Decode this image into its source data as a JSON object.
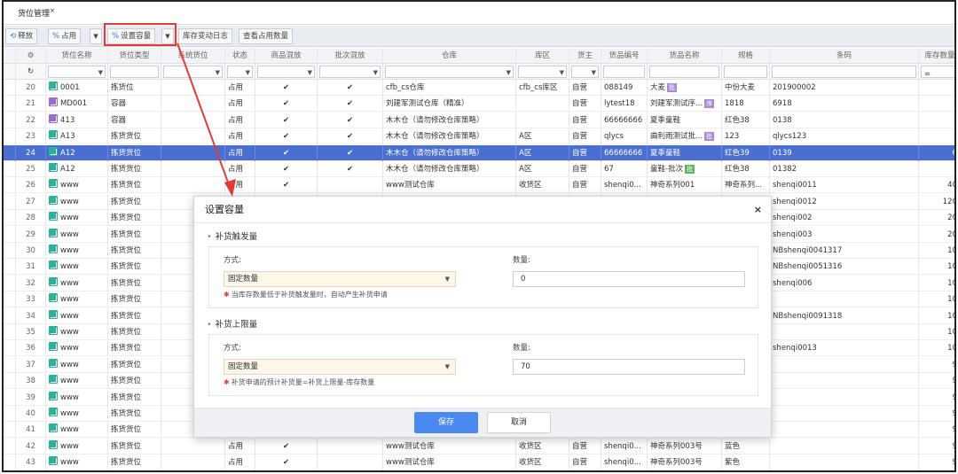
{
  "tab": {
    "title": "货位管理",
    "close": "×"
  },
  "toolbar": {
    "release": "释放",
    "occupy": "占用",
    "set_capacity": "设置容量",
    "stock_log": "库存变动日志",
    "view_occupy": "查看占用数量"
  },
  "columns": [
    "",
    "货位名称",
    "货位类型",
    "系统货位",
    "状态",
    "商品混放",
    "批次混放",
    "仓库",
    "库区",
    "货主",
    "货品编号",
    "货品名称",
    "规格",
    "条码",
    "库存数量"
  ],
  "filter": {
    "stock_op": "="
  },
  "rows": [
    {
      "n": "20",
      "name": "0001",
      "type": "拣货位",
      "status": "占用",
      "mix": "✔",
      "batch": "✔",
      "wh": "cfb_cs仓库",
      "zone": "cfb_cs库区",
      "owner": "自营",
      "code": "088149",
      "goods": "大麦",
      "tag": "批",
      "spec": "中份大麦",
      "barcode": "201900002",
      "qty": "",
      "icon": "green"
    },
    {
      "n": "21",
      "name": "MD001",
      "type": "容器",
      "status": "占用",
      "mix": "✔",
      "batch": "✔",
      "wh": "刘建军测试仓库（精准）",
      "zone": "",
      "owner": "自营",
      "code": "lytest18",
      "goods": "刘建军测试序...",
      "tag": "序",
      "spec": "1818",
      "barcode": "6918",
      "qty": "",
      "icon": "purple"
    },
    {
      "n": "22",
      "name": "413",
      "type": "容器",
      "status": "占用",
      "mix": "✔",
      "batch": "✔",
      "wh": "木木仓（请勿修改仓库策略）",
      "zone": "",
      "owner": "自营",
      "code": "66666666",
      "goods": "夏季童鞋",
      "tag": "",
      "spec": "红色38",
      "barcode": "0138",
      "qty": "",
      "icon": "purple"
    },
    {
      "n": "23",
      "name": "A13",
      "type": "拣货货位",
      "status": "占用",
      "mix": "✔",
      "batch": "✔",
      "wh": "木木仓（请勿修改仓库策略）",
      "zone": "A区",
      "owner": "自营",
      "code": "qlycs",
      "goods": "曲利雨测试批...",
      "tag": "批",
      "spec": "123",
      "barcode": "qlycs123",
      "qty": "",
      "icon": "green"
    },
    {
      "n": "24",
      "name": "A12",
      "type": "拣货货位",
      "status": "占用",
      "mix": "✔",
      "batch": "✔",
      "wh": "木木仓（请勿修改仓库策略）",
      "zone": "A区",
      "owner": "自营",
      "code": "66666666",
      "goods": "夏季童鞋",
      "tag": "",
      "spec": "红色39",
      "barcode": "0139",
      "qty": "6",
      "icon": "green",
      "selected": true
    },
    {
      "n": "25",
      "name": "A12",
      "type": "拣货货位",
      "status": "占用",
      "mix": "✔",
      "batch": "✔",
      "wh": "木木仓（请勿修改仓库策略）",
      "zone": "A区",
      "owner": "自营",
      "code": "67",
      "goods": "童鞋-批次",
      "tag": "批",
      "spec": "红色38",
      "barcode": "01382",
      "qty": "",
      "icon": "green"
    },
    {
      "n": "26",
      "name": "www",
      "type": "拣货货位",
      "status": "占用",
      "mix": "✔",
      "batch": "",
      "wh": "www测试仓库",
      "zone": "收货区",
      "owner": "自营",
      "code": "shenqi0...",
      "goods": "神奇系列001",
      "tag": "",
      "spec": "神奇系列...",
      "barcode": "shenqi0011",
      "qty": "40",
      "icon": "green"
    },
    {
      "n": "27",
      "name": "www",
      "type": "拣货货位",
      "status": "",
      "mix": "",
      "batch": "",
      "wh": "",
      "zone": "",
      "owner": "",
      "code": "",
      "goods": "",
      "tag": "",
      "spec": "",
      "barcode": "shenqi0012",
      "qty": "120",
      "icon": "green"
    },
    {
      "n": "28",
      "name": "www",
      "type": "拣货货位",
      "status": "",
      "mix": "",
      "batch": "",
      "wh": "",
      "zone": "",
      "owner": "",
      "code": "",
      "goods": "",
      "tag": "",
      "spec": "",
      "barcode": "shenqi002",
      "qty": "20",
      "icon": "green"
    },
    {
      "n": "29",
      "name": "www",
      "type": "拣货货位",
      "status": "",
      "mix": "",
      "batch": "",
      "wh": "",
      "zone": "",
      "owner": "",
      "code": "",
      "goods": "",
      "tag": "",
      "spec": "",
      "barcode": "shenqi003",
      "qty": "20",
      "icon": "green"
    },
    {
      "n": "30",
      "name": "www",
      "type": "拣货货位",
      "status": "",
      "mix": "",
      "batch": "",
      "wh": "",
      "zone": "",
      "owner": "",
      "code": "",
      "goods": "",
      "tag": "",
      "spec": "",
      "barcode": "NBshenqi0041317",
      "qty": "10",
      "icon": "green"
    },
    {
      "n": "31",
      "name": "www",
      "type": "拣货货位",
      "status": "",
      "mix": "",
      "batch": "",
      "wh": "",
      "zone": "",
      "owner": "",
      "code": "",
      "goods": "",
      "tag": "",
      "spec": "",
      "barcode": "NBshenqi0051316",
      "qty": "10",
      "icon": "green"
    },
    {
      "n": "32",
      "name": "www",
      "type": "拣货货位",
      "status": "",
      "mix": "",
      "batch": "",
      "wh": "",
      "zone": "",
      "owner": "",
      "code": "",
      "goods": "",
      "tag": "",
      "spec": "",
      "barcode": "shenqi006",
      "qty": "10",
      "icon": "green"
    },
    {
      "n": "33",
      "name": "www",
      "type": "拣货货位",
      "status": "",
      "mix": "",
      "batch": "",
      "wh": "",
      "zone": "",
      "owner": "",
      "code": "",
      "goods": "",
      "tag": "",
      "spec": "",
      "barcode": "",
      "qty": "10",
      "icon": "green"
    },
    {
      "n": "34",
      "name": "www",
      "type": "拣货货位",
      "status": "",
      "mix": "",
      "batch": "",
      "wh": "",
      "zone": "",
      "owner": "",
      "code": "",
      "goods": "",
      "tag": "",
      "spec": "",
      "barcode": "NBshenqi0091318",
      "qty": "10",
      "icon": "green"
    },
    {
      "n": "35",
      "name": "www",
      "type": "拣货货位",
      "status": "",
      "mix": "",
      "batch": "",
      "wh": "",
      "zone": "",
      "owner": "",
      "code": "",
      "goods": "",
      "tag": "",
      "spec": "",
      "barcode": "",
      "qty": "10",
      "icon": "green"
    },
    {
      "n": "36",
      "name": "www",
      "type": "拣货货位",
      "status": "",
      "mix": "",
      "batch": "",
      "wh": "",
      "zone": "",
      "owner": "",
      "code": "",
      "goods": "",
      "tag": "",
      "spec": "",
      "barcode": "shenqi0013",
      "qty": "10",
      "icon": "green"
    },
    {
      "n": "37",
      "name": "www",
      "type": "拣货货位",
      "status": "",
      "mix": "",
      "batch": "",
      "wh": "",
      "zone": "",
      "owner": "",
      "code": "",
      "goods": "",
      "tag": "",
      "spec": "",
      "barcode": "",
      "qty": "9",
      "icon": "green"
    },
    {
      "n": "38",
      "name": "www",
      "type": "拣货货位",
      "status": "",
      "mix": "",
      "batch": "",
      "wh": "",
      "zone": "",
      "owner": "",
      "code": "",
      "goods": "",
      "tag": "",
      "spec": "",
      "barcode": "",
      "qty": "9",
      "icon": "green"
    },
    {
      "n": "39",
      "name": "www",
      "type": "拣货货位",
      "status": "",
      "mix": "",
      "batch": "",
      "wh": "",
      "zone": "",
      "owner": "",
      "code": "",
      "goods": "",
      "tag": "",
      "spec": "",
      "barcode": "",
      "qty": "9",
      "icon": "green"
    },
    {
      "n": "40",
      "name": "www",
      "type": "拣货货位",
      "status": "",
      "mix": "",
      "batch": "",
      "wh": "",
      "zone": "",
      "owner": "",
      "code": "",
      "goods": "",
      "tag": "",
      "spec": "",
      "barcode": "",
      "qty": "9",
      "icon": "green"
    },
    {
      "n": "41",
      "name": "www",
      "type": "拣货货位",
      "status": "",
      "mix": "",
      "batch": "",
      "wh": "",
      "zone": "",
      "owner": "",
      "code": "",
      "goods": "",
      "tag": "",
      "spec": "",
      "barcode": "",
      "qty": "9",
      "icon": "green"
    },
    {
      "n": "42",
      "name": "www",
      "type": "拣货货位",
      "status": "占用",
      "mix": "✔",
      "batch": "",
      "wh": "www测试仓库",
      "zone": "收货区",
      "owner": "自营",
      "code": "shenqi0...",
      "goods": "神奇系列003号",
      "tag": "",
      "spec": "蓝色",
      "barcode": "",
      "qty": "9",
      "icon": "green"
    },
    {
      "n": "43",
      "name": "www",
      "type": "拣货货位",
      "status": "占用",
      "mix": "✔",
      "batch": "",
      "wh": "www测试仓库",
      "zone": "收货区",
      "owner": "自营",
      "code": "shenqi0...",
      "goods": "神奇系列003号",
      "tag": "",
      "spec": "紫色",
      "barcode": "",
      "qty": "9",
      "icon": "green"
    }
  ],
  "modal": {
    "title": "设置容量",
    "close": "×",
    "section1": {
      "title": "补货触发量",
      "method_label": "方式:",
      "method_value": "固定数量",
      "qty_label": "数量:",
      "qty_value": "0",
      "hint": "当库存数量低于补货触发量时，自动产生补货申请"
    },
    "section2": {
      "title": "补货上限量",
      "method_label": "方式:",
      "method_value": "固定数量",
      "qty_label": "数量:",
      "qty_value": "70",
      "hint": "补货申请的预计补货量=补货上限量-库存数量"
    },
    "save": "保存",
    "cancel": "取消"
  },
  "colors": {
    "accent": "#4a8af0",
    "selected_row": "#4a6fd0",
    "highlight": "#e53935"
  }
}
